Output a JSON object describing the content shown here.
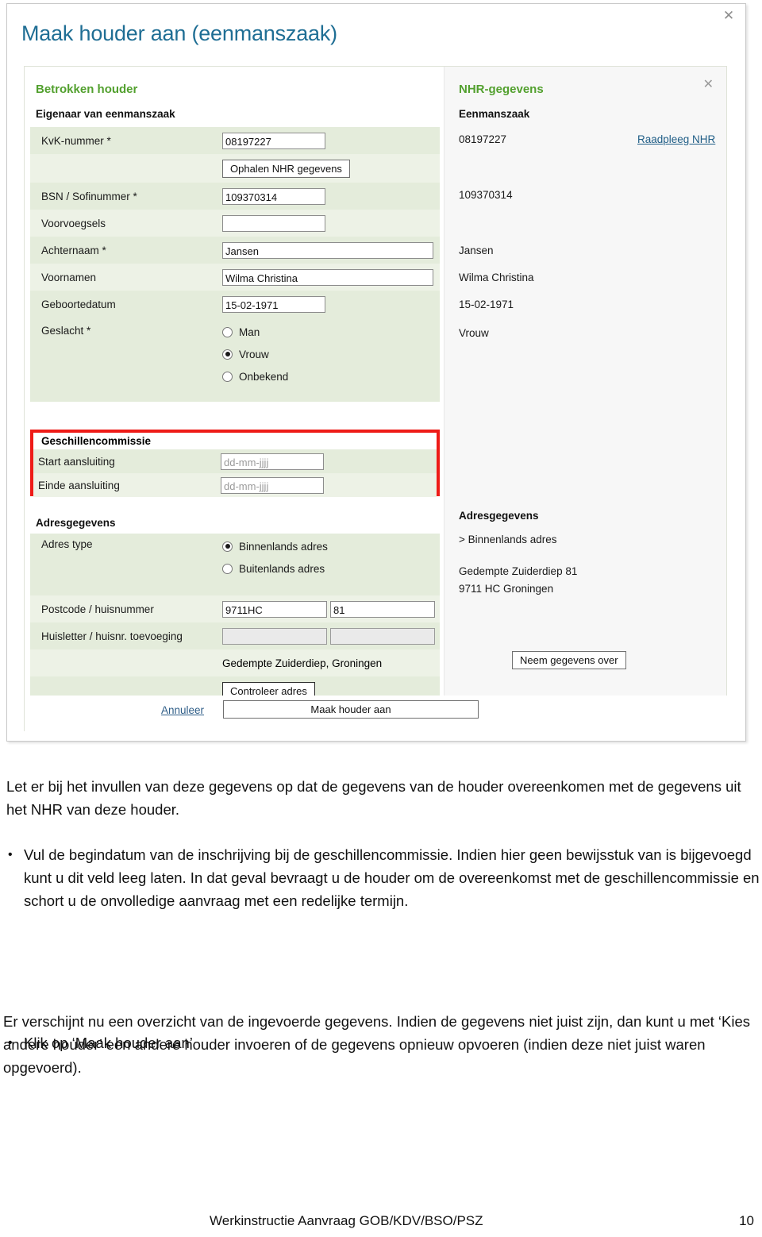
{
  "window": {
    "title": "Maak houder aan (eenmanszaak)",
    "close_icon": "close-icon"
  },
  "left_panel": {
    "section_title": "Betrokken houder",
    "sub_title": "Eigenaar van eenmanszaak",
    "rows": {
      "kvk_label": "KvK-nummer *",
      "kvk_value": "08197227",
      "ophalen_button": "Ophalen NHR gegevens",
      "bsn_label": "BSN / Sofinummer *",
      "bsn_value": "109370314",
      "voorvoegsels_label": "Voorvoegsels",
      "voorvoegsels_value": "",
      "achternaam_label": "Achternaam *",
      "achternaam_value": "Jansen",
      "voornamen_label": "Voornamen",
      "voornamen_value": "Wilma Christina",
      "geboortedatum_label": "Geboortedatum",
      "geboortedatum_value": "15-02-1971",
      "geslacht_label": "Geslacht *",
      "geslacht_options": [
        "Man",
        "Vrouw",
        "Onbekend"
      ],
      "geslacht_selected": "Vrouw"
    },
    "geschillencommissie": {
      "heading": "Geschillencommissie",
      "start_label": "Start aansluiting",
      "start_placeholder": "dd-mm-jjjj",
      "einde_label": "Einde aansluiting",
      "einde_placeholder": "dd-mm-jjjj",
      "highlight_color": "#ee1b17"
    },
    "adres": {
      "heading": "Adresgegevens",
      "type_label": "Adres type",
      "type_options": [
        "Binnenlands adres",
        "Buitenlands adres"
      ],
      "type_selected": "Binnenlands adres",
      "postcode_label": "Postcode / huisnummer",
      "postcode_value": "9711HC",
      "huisnummer_value": "81",
      "huisletter_label": "Huisletter / huisnr. toevoeging",
      "huisletter_value": "",
      "toevoeging_value": "",
      "street_summary": "Gedempte Zuiderdiep,  Groningen",
      "controleer_button": "Controleer adres"
    }
  },
  "right_panel": {
    "section_title": "NHR-gegevens",
    "close_icon": "close-icon",
    "sub_title": "Eenmanszaak",
    "kvk_value": "08197227",
    "raadpleeg_link": "Raadpleeg NHR",
    "bsn_value": "109370314",
    "achternaam_value": "Jansen",
    "voornamen_value": "Wilma Christina",
    "geboortedatum_value": "15-02-1971",
    "geslacht_value": "Vrouw",
    "adres_heading": "Adresgegevens",
    "adres_type": "> Binnenlands adres",
    "adres_line1": "Gedempte Zuiderdiep 81",
    "adres_line2": "9711 HC Groningen",
    "neem_over_button": "Neem gegevens over"
  },
  "footer_bar": {
    "cancel_link": "Annuleer",
    "primary_button": "Maak houder aan"
  },
  "document": {
    "intro": "Let er bij het invullen van deze gegevens op dat de gegevens van de houder overeenkomen met de gegevens uit het NHR van deze houder.",
    "bullet_1": "Vul de begindatum van de inschrijving bij de geschillencommissie. Indien hier geen bewijsstuk van is bijgevoegd kunt u dit veld leeg laten. In dat geval bevraagt u de houder om de overeenkomst met de geschillencommissie en schort u de onvolledige aanvraag met een redelijke termijn.",
    "bullet_2": "Klik op ‘Maak houder aan’",
    "closing": "Er verschijnt nu een overzicht van de ingevoerde gegevens. Indien de gegevens niet juist zijn, dan kunt u met ‘Kies andere houder’ een andere houder invoeren of de gegevens opnieuw opvoeren (indien deze niet juist waren opgevoerd).",
    "footer_left": "Werkinstructie Aanvraag GOB/KDV/BSO/PSZ",
    "footer_page": "10"
  }
}
